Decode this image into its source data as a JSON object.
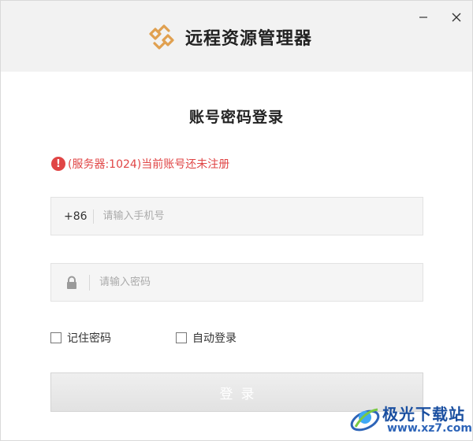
{
  "window": {
    "title": "远程资源管理器",
    "minimize_icon": "minimize-icon",
    "close_icon": "close-icon"
  },
  "login": {
    "heading": "账号密码登录",
    "error_message": "(服务器:1024)当前账号还未注册",
    "error_icon_glyph": "!",
    "phone_prefix": "+86",
    "phone_placeholder": "请输入手机号",
    "phone_value": "",
    "password_placeholder": "请输入密码",
    "password_value": "",
    "remember_label": "记住密码",
    "remember_checked": false,
    "auto_login_label": "自动登录",
    "auto_login_checked": false,
    "submit_label": "登录"
  },
  "watermark": {
    "brand": "极光下载站",
    "url": "www.xz7.com"
  },
  "colors": {
    "error": "#e04545",
    "logo": "#e0a050",
    "titlebar_bg": "#f2f2f2",
    "button_bg": "#e8e8e8"
  }
}
